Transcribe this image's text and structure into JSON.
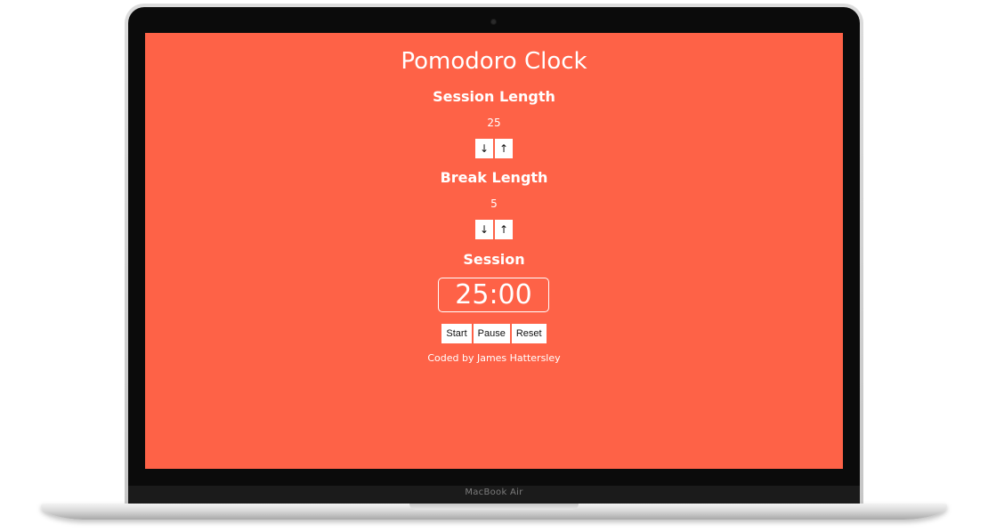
{
  "device": {
    "brand_label": "MacBook Air"
  },
  "app": {
    "title": "Pomodoro Clock",
    "session": {
      "label": "Session Length",
      "value": "25",
      "decrement_icon": "↓",
      "increment_icon": "↑"
    },
    "break": {
      "label": "Break Length",
      "value": "5",
      "decrement_icon": "↓",
      "increment_icon": "↑"
    },
    "mode_label": "Session",
    "timer_display": "25:00",
    "controls": {
      "start": "Start",
      "pause": "Pause",
      "reset": "Reset"
    },
    "footer": "Coded by James Hattersley",
    "colors": {
      "background": "#fe6247",
      "text": "#ffffff",
      "button": "#ffffff"
    }
  }
}
